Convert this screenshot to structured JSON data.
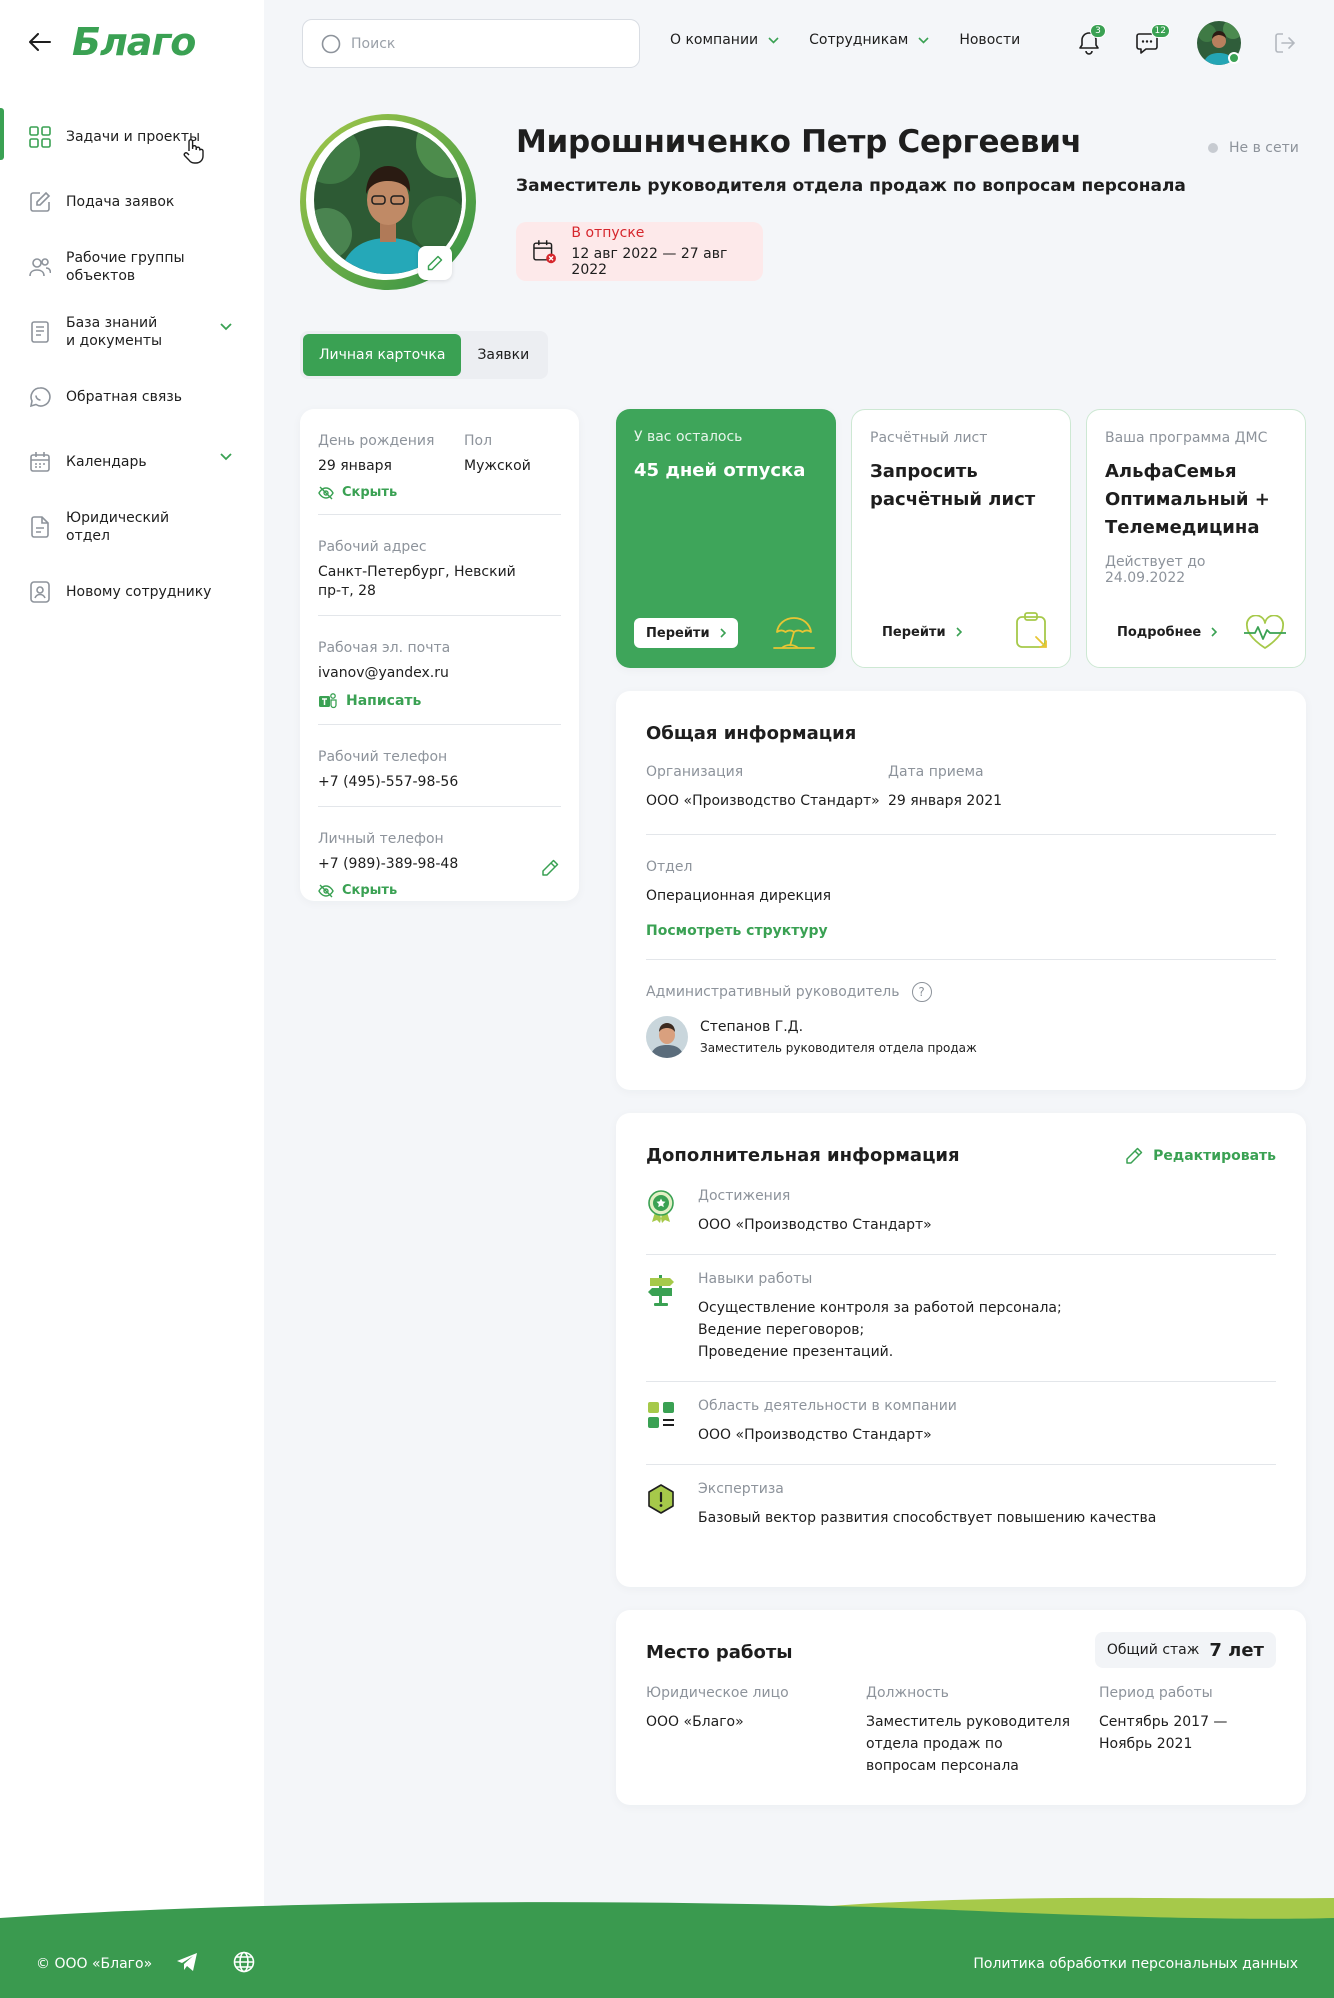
{
  "app": {
    "logo": "Благо"
  },
  "sidebar": {
    "items": [
      {
        "label": "Задачи и проекты",
        "icon": "grid-icon",
        "active": true,
        "has_submenu": false
      },
      {
        "label": "Подача заявок",
        "icon": "edit-note-icon",
        "active": false,
        "has_submenu": false
      },
      {
        "label": "Рабочие группы\nобъектов",
        "icon": "users-group-icon",
        "active": false,
        "has_submenu": false
      },
      {
        "label": "База знаний\nи документы",
        "icon": "document-icon",
        "active": false,
        "has_submenu": true
      },
      {
        "label": "Обратная связь",
        "icon": "chat-icon",
        "active": false,
        "has_submenu": false
      },
      {
        "label": "Календарь",
        "icon": "calendar-icon",
        "active": false,
        "has_submenu": true
      },
      {
        "label": "Юридический отдел",
        "icon": "legal-doc-icon",
        "active": false,
        "has_submenu": false
      },
      {
        "label": "Новому сотруднику",
        "icon": "badge-user-icon",
        "active": false,
        "has_submenu": false
      }
    ]
  },
  "header": {
    "search_placeholder": "Поиск",
    "nav": [
      {
        "label": "О компании",
        "dropdown": true
      },
      {
        "label": "Сотрудникам",
        "dropdown": true
      },
      {
        "label": "Новости",
        "dropdown": false
      }
    ],
    "notifications_count": "3",
    "messages_count": "12"
  },
  "profile": {
    "name": "Мирошниченко Петр Сергеевич",
    "position": "Заместитель руководителя отдела продаж по вопросам персонала",
    "status": "Не в сети",
    "vacation_label": "В отпуске",
    "vacation_dates": "12 авг 2022 — 27 авг 2022"
  },
  "tabs": [
    {
      "label": "Личная карточка",
      "active": true
    },
    {
      "label": "Заявки",
      "active": false
    }
  ],
  "contact": {
    "birthday_label": "День рождения",
    "birthday": "29 января",
    "gender_label": "Пол",
    "gender": "Мужской",
    "hide_label": "Скрыть",
    "address_label": "Рабочий адрес",
    "address": "Санкт-Петербург, Невский пр-т, 28",
    "email_label": "Рабочая эл. почта",
    "email": "ivanov@yandex.ru",
    "write_label": "Написать",
    "work_phone_label": "Рабочий телефон",
    "work_phone": "+7 (495)-557-98-56",
    "personal_phone_label": "Личный телефон",
    "personal_phone": "+7 (989)-389-98-48"
  },
  "summary_cards": [
    {
      "label": "У вас осталось",
      "value": "45 дней отпуска",
      "sub": "",
      "button": "Перейти",
      "icon": "beach-umbrella-icon",
      "style": "green"
    },
    {
      "label": "Расчётный лист",
      "value": "Запросить расчётный лист",
      "sub": "",
      "button": "Перейти",
      "icon": "clipboard-arrow-icon",
      "style": "outline"
    },
    {
      "label": "Ваша программа ДМС",
      "value": "АльфаСемья Оптимальный + Телемедицина",
      "sub": "Действует до 24.09.2022",
      "button": "Подробнее",
      "icon": "heart-pulse-icon",
      "style": "outline"
    }
  ],
  "general": {
    "title": "Общая информация",
    "org_label": "Организация",
    "org": "ООО «Производство Стандарт»",
    "hire_label": "Дата приема",
    "hire": "29 января 2021",
    "dept_label": "Отдел",
    "dept": "Операционная дирекция",
    "structure_link": "Посмотреть структуру",
    "manager_label": "Административный руководитель",
    "manager_name": "Степанов Г.Д.",
    "manager_position": "Заместитель руководителя отдела продаж"
  },
  "additional": {
    "title": "Дополнительная информация",
    "edit_label": "Редактировать",
    "rows": [
      {
        "label": "Достижения",
        "value": "ООО «Производство Стандарт»",
        "icon": "medal-icon"
      },
      {
        "label": "Навыки работы",
        "value": "Осуществление контроля за работой персонала;\nВедение переговоров;\nПроведение презентаций.",
        "icon": "signpost-icon"
      },
      {
        "label": "Область деятельности в компании",
        "value": "ООО «Производство Стандарт»",
        "icon": "blocks-icon"
      },
      {
        "label": "Экспертиза",
        "value": "Базовый вектор развития способствует повышению качества",
        "icon": "shield-alert-icon"
      }
    ]
  },
  "workplace": {
    "title": "Место работы",
    "exp_label": "Общий стаж",
    "exp_value": "7 лет",
    "entity_label": "Юридическое лицо",
    "entity": "ООО «Благо»",
    "role_label": "Должность",
    "role": "Заместитель руководителя отдела продаж по вопросам персонала",
    "period_label": "Период работы",
    "period": "Сентябрь 2017 — Ноябрь 2021"
  },
  "footer": {
    "copyright": "© ООО «Благо»",
    "privacy": "Политика обработки персональных данных"
  },
  "colors": {
    "accent": "#3aa153",
    "accent_light": "#a6c94a",
    "danger": "#d6262c",
    "muted": "#8d939b"
  }
}
